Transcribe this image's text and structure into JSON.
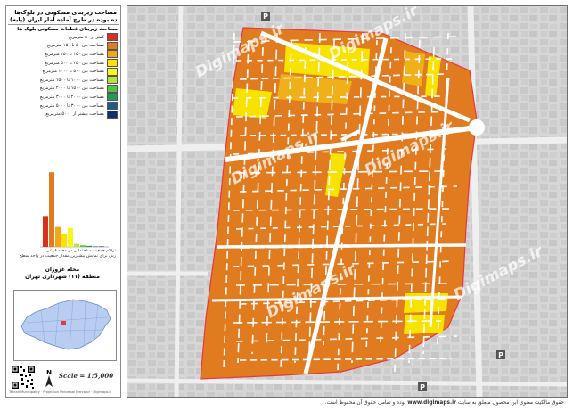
{
  "title": {
    "line1": "مساحت زیربنای مسکونی در بلوک‌ها",
    "line2": "براساس ماده بوده در طرح آماده آمار ایران (پایه)"
  },
  "legend": {
    "heading": "مساحت زیربنای قطعات مسکونی بلوک ها",
    "items": [
      {
        "label": "کمتر از ۵۰ مترمربع",
        "color": "#d7301f"
      },
      {
        "label": "مساحت بین ۵۰ تا ۱۵۰ مترمربع",
        "color": "#e07b20"
      },
      {
        "label": "مساحت بین ۱۵۰ تا ۲۵۰ مترمربع",
        "color": "#f0a818"
      },
      {
        "label": "مساحت بین ۲۵۰ تا ۵۰۰ مترمربع",
        "color": "#ffdf00"
      },
      {
        "label": "مساحت بین ۵۰۰ تا ۱۰۰۰ مترمربع",
        "color": "#f7f71a"
      },
      {
        "label": "مساحت بین ۱۰۰۰ تا ۱۵۰۰ مترمربع",
        "color": "#b7e33a"
      },
      {
        "label": "مساحت بین ۱۵۰۰ تا ۲۰۰۰ مترمربع",
        "color": "#56c443"
      },
      {
        "label": "مساحت بین ۲۰۰۰ تا ۳۰۰۰ مترمربع",
        "color": "#1f9a57"
      },
      {
        "label": "مساحت بین ۳۰۰۰ تا ۵۰۰۰ مترمربع",
        "color": "#1f5a8a"
      },
      {
        "label": "مساحت بیشتر از ۵۰۰۰ مترمربع",
        "color": "#0d2f6e"
      }
    ]
  },
  "histogram": {
    "values": [
      62,
      150,
      40,
      27,
      38,
      6,
      3,
      2,
      1,
      1
    ],
    "max": 170
  },
  "hist_note": {
    "line1": "تراکم جمعیت ساختمانی در محله فرعی",
    "line2": "رنگ برای نمایش بیشترین مقدار جمعیت در واحد سطح"
  },
  "location": {
    "line1": "محله غزوزان",
    "line2": "منطقه (۱۱) شهرداری تهران"
  },
  "scale": {
    "text": "Scale = 1:5,000"
  },
  "credit": "Tehran Municipality · Projection Universal Mercator · Digimaps.ir",
  "watermarks": [
    "Digimaps.ir",
    "Digimaps.ir",
    "Digimaps.ir",
    "Digimaps.ir",
    "Digimaps.ir",
    "Digimaps.ir"
  ],
  "footer": {
    "part1": "حقوق مالکیت معنوی این محصول متعلق به سایت",
    "link": "www.digimaps.ir",
    "part2": "بوده و تمامی حقوق آن محفوظ است."
  },
  "colors": {
    "block_orange": "#e07b20",
    "block_yellow": "#ffdf00",
    "block_light": "#f0a818",
    "street": "#ffffff",
    "background": "#d9d9d9",
    "boundary": "#e8383d"
  }
}
